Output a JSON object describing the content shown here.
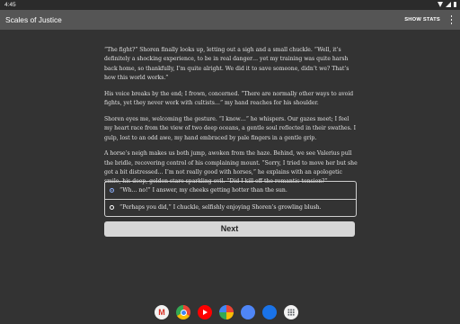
{
  "status_bar": {
    "time": "4:45"
  },
  "app_bar": {
    "title": "Scales of Justice",
    "stats_label": "SHOW STATS"
  },
  "story": {
    "paragraphs": [
      "“The fight?” Shoren finally looks up, letting out a sigh and a small chuckle. “Well, it’s definitely a shocking experience, to be in real danger… yet my training was quite harsh back home, so thankfully, I’m quite alright. We did it to save someone, didn’t we? That’s how this world works.”",
      "His voice breaks by the end; I frown, concerned. “There are normally other ways to avoid fights, yet they never work with cultists…” my hand reaches for his shoulder.",
      "Shoren eyes me, welcoming the gesture. “I know…” he whispers. Our gazes meet; I feel my heart race from the view of two deep oceans, a gentle soul reflected in their swathes. I gulp, lost to an odd awe, my hand embraced by pale fingers in a gentle grip.",
      "A horse’s neigh makes us both jump, awoken from the haze. Behind, we see Valerius pull the bridle, recovering control of his complaining mount. “Sorry, I tried to move her but she got a bit distressed… I’m not really good with horses,” he explains with an apologetic smile, his deep, golden stare sparkling evil. “Did I kill off the romantic tension?”"
    ]
  },
  "choices": [
    {
      "label": "“Wh… no!” I answer, my cheeks getting hotter than the sun.",
      "selected": true
    },
    {
      "label": "“Perhaps you did,” I chuckle, selfishly enjoying Shoren’s growling blush.",
      "selected": false
    }
  ],
  "next_button": {
    "label": "Next"
  },
  "dock": {
    "apps": [
      "gmail-icon",
      "chrome-icon",
      "youtube-icon",
      "photos-icon",
      "phone-icon",
      "messages-icon",
      "apps-icon"
    ],
    "gmail_glyph": "M"
  }
}
